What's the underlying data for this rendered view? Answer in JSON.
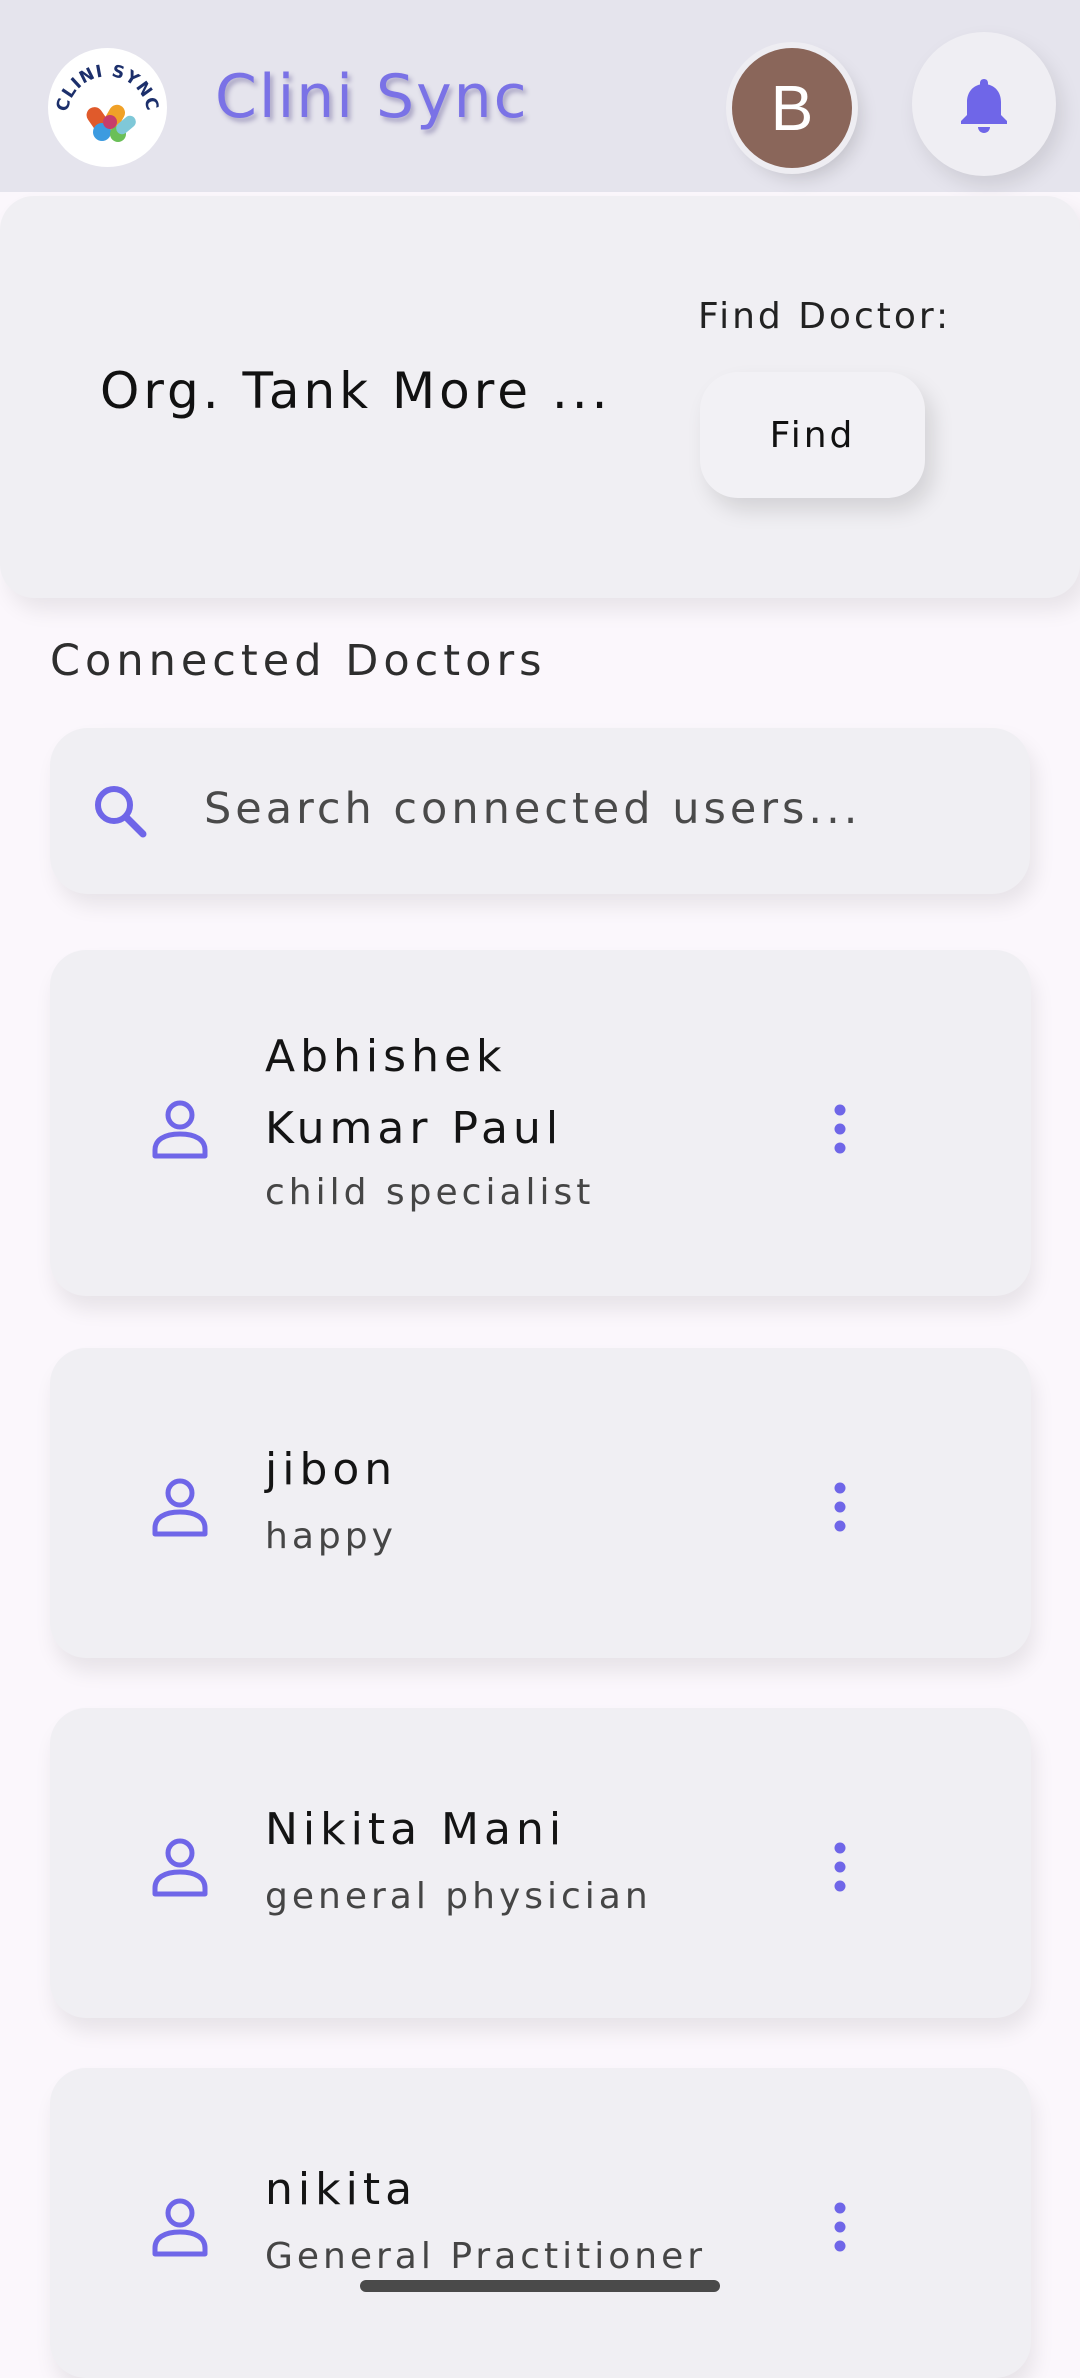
{
  "header": {
    "logo_text": "CLINI SYNC",
    "app_title": "Clini Sync",
    "avatar_initial": "B",
    "bell_icon": "notification-bell-icon"
  },
  "org_card": {
    "org_name": "Org. Tank More ...",
    "find_label": "Find Doctor:",
    "find_button_label": "Find"
  },
  "connected": {
    "section_title": "Connected Doctors",
    "search_placeholder": "Search connected users...",
    "doctors": [
      {
        "name": "Abhishek Kumar Paul",
        "specialty": "child specialist"
      },
      {
        "name": "jibon",
        "specialty": "happy"
      },
      {
        "name": "Nikita Mani",
        "specialty": "general physician"
      },
      {
        "name": "nikita",
        "specialty": "General Practitioner"
      }
    ]
  },
  "colors": {
    "accent": "#7068e6",
    "appbar_bg": "#e5e4ed",
    "card_bg": "#f0eff3",
    "avatar_bg": "#8a665a",
    "page_bg": "#fbf7fc"
  }
}
